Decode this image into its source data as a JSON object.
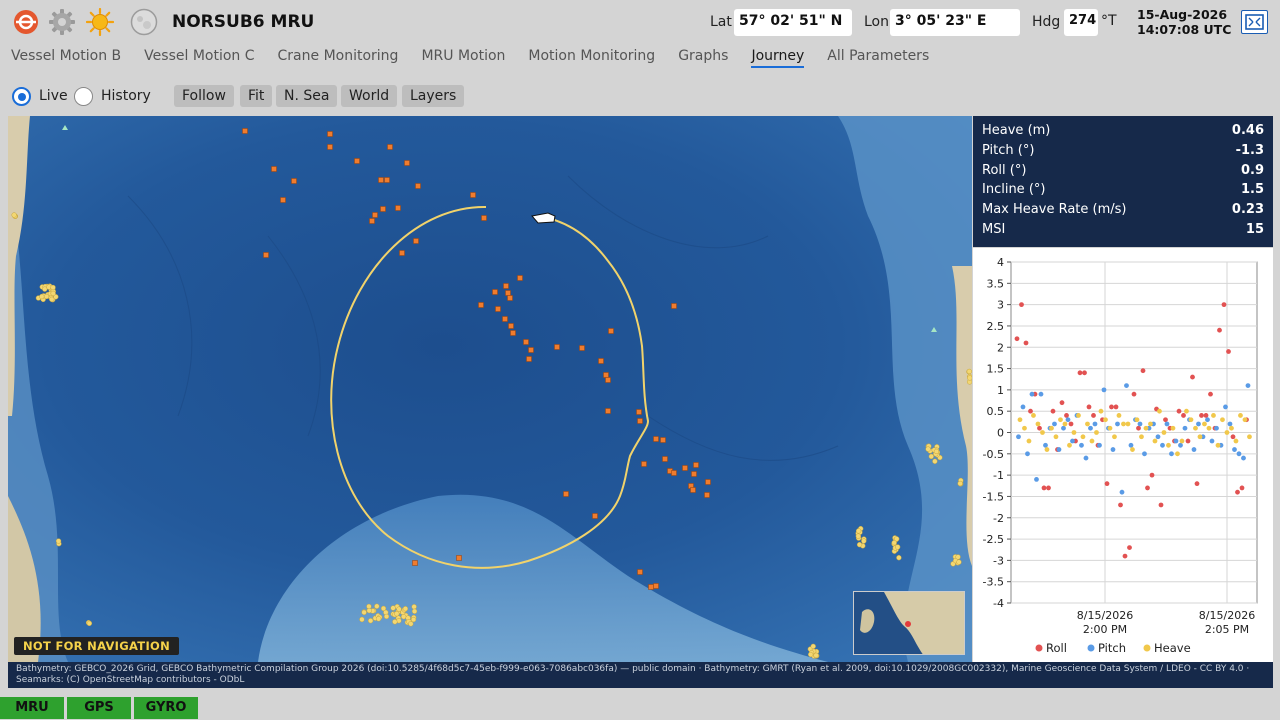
{
  "header": {
    "title": "NORSUB6 MRU",
    "lat_label": "Lat",
    "lat_value": "57° 02' 51\" N",
    "lon_label": "Lon",
    "lon_value": "3° 05' 23\" E",
    "hdg_label": "Hdg",
    "hdg_value": "274",
    "hdg_unit": "°T",
    "date": "15-Aug-2026",
    "time": "14:07:08 UTC",
    "icons": [
      "norsub-logo-icon",
      "settings-gear-icon",
      "sun-icon",
      "moon-icon",
      "expand-icon"
    ]
  },
  "tabs": [
    {
      "label": "Vessel Motion B",
      "active": false
    },
    {
      "label": "Vessel Motion C",
      "active": false
    },
    {
      "label": "Crane Monitoring",
      "active": false
    },
    {
      "label": "MRU Motion",
      "active": false
    },
    {
      "label": "Motion Monitoring",
      "active": false
    },
    {
      "label": "Graphs",
      "active": false
    },
    {
      "label": "Journey",
      "active": true
    },
    {
      "label": "All Parameters",
      "active": false
    }
  ],
  "mode": {
    "live_label": "Live",
    "history_label": "History",
    "selected": "Live"
  },
  "map_buttons": [
    "Follow",
    "Fit",
    "N. Sea",
    "World",
    "Layers"
  ],
  "map": {
    "nfn_label": "NOT FOR NAVIGATION",
    "colors": {
      "sea_deep": "#1c4f8f",
      "sea_mid": "#2f6db0",
      "sea_shelf": "#6fa3cf",
      "land": "#d8ccac",
      "track": "#f1d36b",
      "poi": "#f07c2d"
    }
  },
  "readout": {
    "rows": [
      {
        "label": "Heave (m)",
        "value": "0.46"
      },
      {
        "label": "Pitch (°)",
        "value": "-1.3"
      },
      {
        "label": "Roll (°)",
        "value": "0.9"
      },
      {
        "label": "Incline (°)",
        "value": "1.5"
      },
      {
        "label": "Max Heave Rate (m/s)",
        "value": "0.23"
      },
      {
        "label": "MSI",
        "value": "15"
      }
    ]
  },
  "chart_data": {
    "type": "scatter",
    "ylim": [
      -4,
      4
    ],
    "yticks": [
      4,
      3.5,
      3,
      2.5,
      2,
      1.5,
      1,
      0.5,
      0,
      -0.5,
      -1,
      -1.5,
      -2,
      -2.5,
      -3,
      -3.5,
      -4
    ],
    "xtick_labels": [
      {
        "date": "8/15/2026",
        "time": "2:00 PM"
      },
      {
        "date": "8/15/2026",
        "time": "2:05 PM"
      }
    ],
    "grid": true,
    "legend_position": "bottom",
    "series": [
      {
        "name": "Roll",
        "color": "#e25252",
        "values": [
          2.2,
          3.0,
          2.1,
          0.5,
          0.9,
          0.1,
          -1.3,
          -1.3,
          0.5,
          -0.4,
          0.7,
          0.4,
          0.2,
          -0.2,
          1.4,
          1.4,
          0.6,
          0.4,
          -0.3,
          0.3,
          -1.2,
          0.6,
          0.6,
          -1.7,
          -2.9,
          -2.7,
          0.9,
          0.1,
          1.45,
          -1.3,
          -1.0,
          0.55,
          -1.7,
          0.3,
          0.1,
          -0.2,
          0.5,
          0.4,
          -0.2,
          1.3,
          -1.2,
          0.4,
          0.4,
          0.9,
          0.1,
          2.4,
          3.0,
          1.9,
          -0.1,
          -1.4,
          -1.3,
          0.3
        ]
      },
      {
        "name": "Pitch",
        "color": "#5a9be6",
        "values": [
          -0.1,
          0.6,
          -0.5,
          0.9,
          -1.1,
          0.9,
          -0.3,
          0.1,
          0.2,
          -0.4,
          0.1,
          0.3,
          -0.2,
          0.4,
          -0.3,
          -0.6,
          0.1,
          0.2,
          -0.3,
          1.0,
          0.1,
          -0.4,
          0.2,
          -1.4,
          1.1,
          -0.3,
          0.3,
          0.2,
          -0.5,
          0.1,
          0.2,
          -0.1,
          -0.3,
          0.2,
          -0.5,
          -0.2,
          -0.3,
          0.1,
          0.3,
          -0.4,
          0.2,
          -0.1,
          0.3,
          -0.2,
          0.1,
          -0.3,
          0.6,
          0.2,
          -0.4,
          -0.5,
          -0.6,
          1.1
        ]
      },
      {
        "name": "Heave",
        "color": "#f1c84b",
        "values": [
          0.3,
          0.1,
          -0.2,
          0.4,
          0.2,
          0.0,
          -0.4,
          0.1,
          -0.1,
          0.3,
          0.2,
          -0.3,
          0.0,
          0.4,
          -0.1,
          0.2,
          -0.2,
          0.0,
          0.5,
          0.3,
          0.1,
          -0.1,
          0.4,
          0.2,
          0.2,
          -0.4,
          0.3,
          -0.1,
          0.1,
          0.2,
          -0.2,
          0.5,
          0.0,
          -0.3,
          0.1,
          -0.5,
          -0.2,
          0.5,
          0.3,
          0.1,
          -0.1,
          0.2,
          0.1,
          0.4,
          -0.3,
          0.3,
          0.0,
          0.1,
          -0.2,
          0.4,
          0.3,
          -0.1
        ]
      }
    ]
  },
  "attribution": "Bathymetry: GEBCO_2026 Grid, GEBCO Bathymetric Compilation Group 2026 (doi:10.5285/4f68d5c7-45eb-f999-e063-7086abc036fa) — public domain  ·  Bathymetry: GMRT (Ryan et al. 2009, doi:10.1029/2008GC002332), Marine Geoscience Data System / LDEO - CC BY 4.0  ·  Seamarks: (C) OpenStreetMap contributors - ODbL",
  "status": [
    "MRU",
    "GPS",
    "GYRO"
  ]
}
